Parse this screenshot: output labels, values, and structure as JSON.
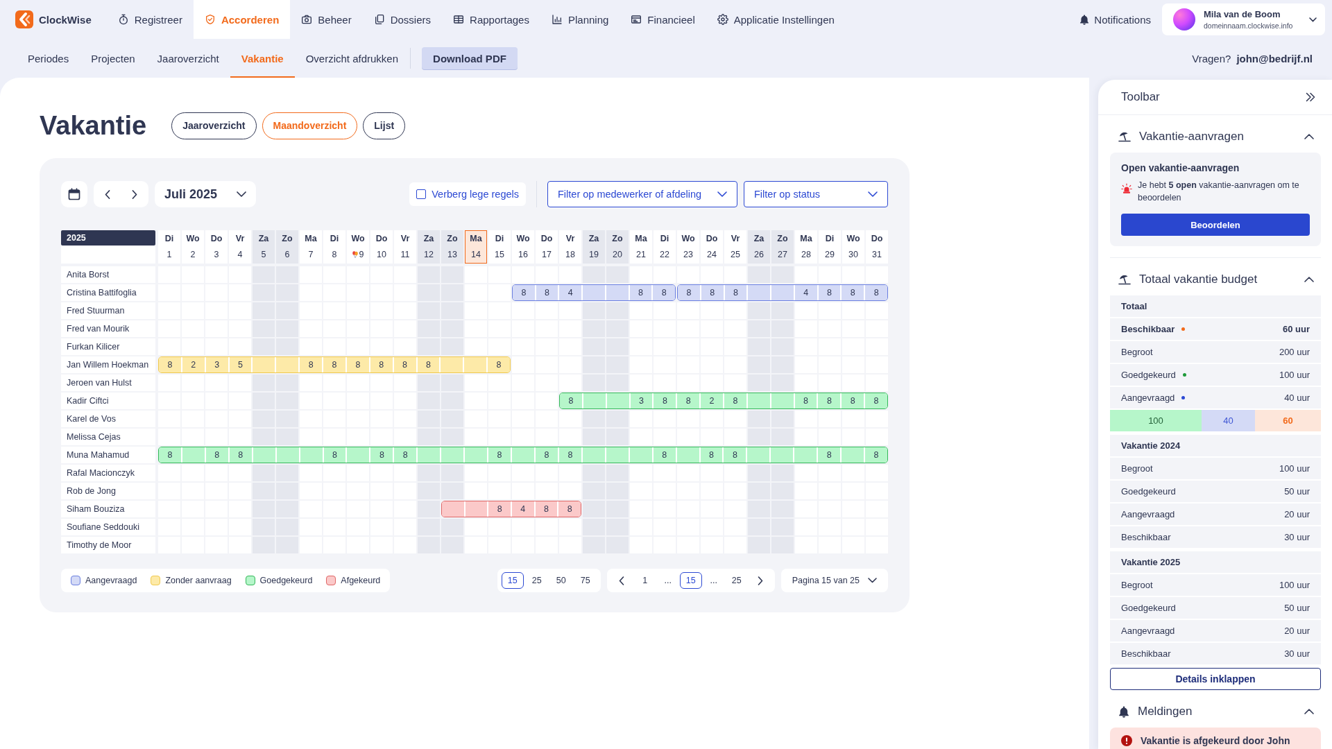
{
  "app": {
    "name": "ClockWise"
  },
  "nav": [
    {
      "label": "Registreer",
      "selected": false
    },
    {
      "label": "Accorderen",
      "selected": true
    },
    {
      "label": "Beheer",
      "selected": false
    },
    {
      "label": "Dossiers",
      "selected": false
    },
    {
      "label": "Rapportages",
      "selected": false
    },
    {
      "label": "Planning",
      "selected": false
    },
    {
      "label": "Financieel",
      "selected": false
    },
    {
      "label": "Applicatie Instellingen",
      "selected": false
    }
  ],
  "notifications": {
    "label": "Notifications"
  },
  "user": {
    "name": "Mila van de Boom",
    "domain": "domeinnaam.clockwise.info"
  },
  "subnav": {
    "items": [
      {
        "label": "Periodes",
        "selected": false
      },
      {
        "label": "Projecten",
        "selected": false
      },
      {
        "label": "Jaaroverzicht",
        "selected": false
      },
      {
        "label": "Vakantie",
        "selected": true
      },
      {
        "label": "Overzicht afdrukken",
        "selected": false
      }
    ],
    "download_button": "Download PDF",
    "help_label": "Vragen?",
    "help_email": "john@bedrijf.nl"
  },
  "page": {
    "title": "Vakantie",
    "views": [
      {
        "label": "Jaaroverzicht",
        "selected": false
      },
      {
        "label": "Maandoverzicht",
        "selected": true
      },
      {
        "label": "Lijst",
        "selected": false
      }
    ]
  },
  "calendar": {
    "month": "Juli 2025",
    "hide_empty_rows": {
      "label": "Verberg lege regels",
      "checked": false
    },
    "filters": [
      {
        "label": "Filter op medewerker of afdeling"
      },
      {
        "label": "Filter op status"
      }
    ],
    "year": "2025",
    "days": [
      {
        "weekday": "Di",
        "number": "1",
        "weekend": false,
        "today": false,
        "balloons": false
      },
      {
        "weekday": "Wo",
        "number": "2",
        "weekend": false,
        "today": false,
        "balloons": false
      },
      {
        "weekday": "Do",
        "number": "3",
        "weekend": false,
        "today": false,
        "balloons": false
      },
      {
        "weekday": "Vr",
        "number": "4",
        "weekend": false,
        "today": false,
        "balloons": false
      },
      {
        "weekday": "Za",
        "number": "5",
        "weekend": true,
        "today": false,
        "balloons": false
      },
      {
        "weekday": "Zo",
        "number": "6",
        "weekend": true,
        "today": false,
        "balloons": false
      },
      {
        "weekday": "Ma",
        "number": "7",
        "weekend": false,
        "today": false,
        "balloons": false
      },
      {
        "weekday": "Di",
        "number": "8",
        "weekend": false,
        "today": false,
        "balloons": false
      },
      {
        "weekday": "Wo",
        "number": "9",
        "weekend": false,
        "today": false,
        "balloons": true
      },
      {
        "weekday": "Do",
        "number": "10",
        "weekend": false,
        "today": false,
        "balloons": false
      },
      {
        "weekday": "Vr",
        "number": "11",
        "weekend": false,
        "today": false,
        "balloons": false
      },
      {
        "weekday": "Za",
        "number": "12",
        "weekend": true,
        "today": false,
        "balloons": false
      },
      {
        "weekday": "Zo",
        "number": "13",
        "weekend": true,
        "today": false,
        "balloons": false
      },
      {
        "weekday": "Ma",
        "number": "14",
        "weekend": false,
        "today": true,
        "balloons": false
      },
      {
        "weekday": "Di",
        "number": "15",
        "weekend": false,
        "today": false,
        "balloons": false
      },
      {
        "weekday": "Wo",
        "number": "16",
        "weekend": false,
        "today": false,
        "balloons": false
      },
      {
        "weekday": "Do",
        "number": "17",
        "weekend": false,
        "today": false,
        "balloons": false
      },
      {
        "weekday": "Vr",
        "number": "18",
        "weekend": false,
        "today": false,
        "balloons": false
      },
      {
        "weekday": "Za",
        "number": "19",
        "weekend": true,
        "today": false,
        "balloons": false
      },
      {
        "weekday": "Zo",
        "number": "20",
        "weekend": true,
        "today": false,
        "balloons": false
      },
      {
        "weekday": "Ma",
        "number": "21",
        "weekend": false,
        "today": false,
        "balloons": false
      },
      {
        "weekday": "Di",
        "number": "22",
        "weekend": false,
        "today": false,
        "balloons": false
      },
      {
        "weekday": "Wo",
        "number": "23",
        "weekend": false,
        "today": false,
        "balloons": false
      },
      {
        "weekday": "Do",
        "number": "24",
        "weekend": false,
        "today": false,
        "balloons": false
      },
      {
        "weekday": "Vr",
        "number": "25",
        "weekend": false,
        "today": false,
        "balloons": false
      },
      {
        "weekday": "Za",
        "number": "26",
        "weekend": true,
        "today": false,
        "balloons": false
      },
      {
        "weekday": "Zo",
        "number": "27",
        "weekend": true,
        "today": false,
        "balloons": false
      },
      {
        "weekday": "Ma",
        "number": "28",
        "weekend": false,
        "today": false,
        "balloons": false
      },
      {
        "weekday": "Di",
        "number": "29",
        "weekend": false,
        "today": false,
        "balloons": false
      },
      {
        "weekday": "Wo",
        "number": "30",
        "weekend": false,
        "today": false,
        "balloons": false
      },
      {
        "weekday": "Do",
        "number": "31",
        "weekend": false,
        "today": false,
        "balloons": false
      }
    ],
    "employees": [
      {
        "name": "Anita Borst"
      },
      {
        "name": "Cristina Battifoglia",
        "items": [
          {
            "kind": "empty"
          },
          {
            "kind": "empty"
          },
          {
            "kind": "empty"
          },
          {
            "kind": "empty"
          },
          {
            "kind": "empty"
          },
          {
            "kind": "empty"
          },
          {
            "kind": "empty"
          },
          {
            "kind": "empty"
          },
          {
            "kind": "empty"
          },
          {
            "kind": "empty"
          },
          {
            "kind": "empty"
          },
          {
            "kind": "empty"
          },
          {
            "kind": "empty"
          },
          {
            "kind": "empty"
          },
          {
            "kind": "empty"
          },
          {
            "kind": "requested",
            "cells": [
              {
                "kind": "hours",
                "hours": "8"
              },
              {
                "kind": "hours",
                "hours": "8"
              },
              {
                "kind": "hours",
                "hours": "4"
              },
              {
                "kind": "blank"
              },
              {
                "kind": "blank"
              },
              {
                "kind": "hours",
                "hours": "8"
              },
              {
                "kind": "hours",
                "hours": "8"
              }
            ]
          },
          {
            "kind": "requested",
            "cells": [
              {
                "kind": "hours",
                "hours": "8"
              },
              {
                "kind": "hours",
                "hours": "8"
              },
              {
                "kind": "hours",
                "hours": "8"
              },
              {
                "kind": "blank"
              },
              {
                "kind": "blank"
              },
              {
                "kind": "hours",
                "hours": "4"
              },
              {
                "kind": "hours",
                "hours": "8"
              },
              {
                "kind": "hours",
                "hours": "8"
              },
              {
                "kind": "hours",
                "hours": "8"
              }
            ]
          }
        ]
      },
      {
        "name": "Fred Stuurman"
      },
      {
        "name": "Fred van Mourik"
      },
      {
        "name": "Furkan Kilicer"
      },
      {
        "name": "Jan Willem Hoekman",
        "items": [
          {
            "kind": "unrequested",
            "cells": [
              {
                "kind": "hours",
                "hours": "8"
              },
              {
                "kind": "hours",
                "hours": "2"
              },
              {
                "kind": "hours",
                "hours": "3"
              },
              {
                "kind": "hours",
                "hours": "5"
              },
              {
                "kind": "blank"
              },
              {
                "kind": "blank"
              },
              {
                "kind": "hours",
                "hours": "8"
              },
              {
                "kind": "hours",
                "hours": "8"
              },
              {
                "kind": "hours",
                "hours": "8"
              },
              {
                "kind": "hours",
                "hours": "8"
              },
              {
                "kind": "hours",
                "hours": "8"
              },
              {
                "kind": "hours",
                "hours": "8"
              },
              {
                "kind": "blank"
              },
              {
                "kind": "blank"
              },
              {
                "kind": "hours",
                "hours": "8"
              }
            ]
          },
          {
            "kind": "empty"
          },
          {
            "kind": "empty"
          },
          {
            "kind": "empty"
          },
          {
            "kind": "empty"
          },
          {
            "kind": "empty"
          },
          {
            "kind": "empty"
          },
          {
            "kind": "empty"
          },
          {
            "kind": "empty"
          },
          {
            "kind": "empty"
          },
          {
            "kind": "empty"
          },
          {
            "kind": "empty"
          },
          {
            "kind": "empty"
          },
          {
            "kind": "empty"
          },
          {
            "kind": "empty"
          },
          {
            "kind": "empty"
          },
          {
            "kind": "empty"
          }
        ]
      },
      {
        "name": "Jeroen van Hulst"
      },
      {
        "name": "Kadir Ciftci",
        "items": [
          {
            "kind": "empty"
          },
          {
            "kind": "empty"
          },
          {
            "kind": "empty"
          },
          {
            "kind": "empty"
          },
          {
            "kind": "empty"
          },
          {
            "kind": "empty"
          },
          {
            "kind": "empty"
          },
          {
            "kind": "empty"
          },
          {
            "kind": "empty"
          },
          {
            "kind": "empty"
          },
          {
            "kind": "empty"
          },
          {
            "kind": "empty"
          },
          {
            "kind": "empty"
          },
          {
            "kind": "empty"
          },
          {
            "kind": "empty"
          },
          {
            "kind": "empty"
          },
          {
            "kind": "empty"
          },
          {
            "kind": "approved",
            "cells": [
              {
                "kind": "hours",
                "hours": "8"
              },
              {
                "kind": "blank"
              },
              {
                "kind": "blank"
              },
              {
                "kind": "hours",
                "hours": "3"
              },
              {
                "kind": "hours",
                "hours": "8"
              },
              {
                "kind": "hours",
                "hours": "8"
              },
              {
                "kind": "hours",
                "hours": "2"
              },
              {
                "kind": "hours",
                "hours": "8"
              },
              {
                "kind": "blank"
              },
              {
                "kind": "blank"
              },
              {
                "kind": "hours",
                "hours": "8"
              },
              {
                "kind": "hours",
                "hours": "8"
              },
              {
                "kind": "hours",
                "hours": "8"
              },
              {
                "kind": "hours",
                "hours": "8"
              }
            ]
          }
        ]
      },
      {
        "name": "Karel de Vos"
      },
      {
        "name": "Melissa Cejas"
      },
      {
        "name": "Muna Mahamud",
        "items": [
          {
            "kind": "approved",
            "cells": [
              {
                "kind": "hours",
                "hours": "8"
              },
              {
                "kind": "blank"
              },
              {
                "kind": "hours",
                "hours": "8"
              },
              {
                "kind": "hours",
                "hours": "8"
              },
              {
                "kind": "blank"
              },
              {
                "kind": "blank"
              },
              {
                "kind": "blank"
              },
              {
                "kind": "hours",
                "hours": "8"
              },
              {
                "kind": "blank"
              },
              {
                "kind": "hours",
                "hours": "8"
              },
              {
                "kind": "hours",
                "hours": "8"
              },
              {
                "kind": "blank"
              },
              {
                "kind": "blank"
              },
              {
                "kind": "blank"
              },
              {
                "kind": "hours",
                "hours": "8"
              },
              {
                "kind": "blank"
              },
              {
                "kind": "hours",
                "hours": "8"
              },
              {
                "kind": "hours",
                "hours": "8"
              },
              {
                "kind": "blank"
              },
              {
                "kind": "blank"
              },
              {
                "kind": "blank"
              },
              {
                "kind": "hours",
                "hours": "8"
              },
              {
                "kind": "blank"
              },
              {
                "kind": "hours",
                "hours": "8"
              },
              {
                "kind": "hours",
                "hours": "8"
              },
              {
                "kind": "blank"
              },
              {
                "kind": "blank"
              },
              {
                "kind": "blank"
              },
              {
                "kind": "hours",
                "hours": "8"
              },
              {
                "kind": "blank"
              },
              {
                "kind": "hours",
                "hours": "8"
              }
            ]
          }
        ]
      },
      {
        "name": "Rafal Macionczyk"
      },
      {
        "name": "Rob de Jong"
      },
      {
        "name": "Siham Bouziza",
        "items": [
          {
            "kind": "empty"
          },
          {
            "kind": "empty"
          },
          {
            "kind": "empty"
          },
          {
            "kind": "empty"
          },
          {
            "kind": "empty"
          },
          {
            "kind": "empty"
          },
          {
            "kind": "empty"
          },
          {
            "kind": "empty"
          },
          {
            "kind": "empty"
          },
          {
            "kind": "empty"
          },
          {
            "kind": "empty"
          },
          {
            "kind": "empty"
          },
          {
            "kind": "rejected",
            "cells": [
              {
                "kind": "blank"
              },
              {
                "kind": "blank"
              },
              {
                "kind": "hours",
                "hours": "8"
              },
              {
                "kind": "hours",
                "hours": "4"
              },
              {
                "kind": "hours",
                "hours": "8"
              },
              {
                "kind": "hours",
                "hours": "8"
              }
            ]
          },
          {
            "kind": "empty"
          },
          {
            "kind": "empty"
          },
          {
            "kind": "empty"
          },
          {
            "kind": "empty"
          },
          {
            "kind": "empty"
          },
          {
            "kind": "empty"
          },
          {
            "kind": "empty"
          },
          {
            "kind": "empty"
          },
          {
            "kind": "empty"
          },
          {
            "kind": "empty"
          },
          {
            "kind": "empty"
          },
          {
            "kind": "empty"
          },
          {
            "kind": "empty"
          }
        ]
      },
      {
        "name": "Soufiane Seddouki"
      },
      {
        "name": "Timothy de Moor"
      }
    ],
    "legend": [
      {
        "label": "Aangevraagd",
        "kind": "requested"
      },
      {
        "label": "Zonder aanvraag",
        "kind": "unrequested"
      },
      {
        "label": "Goedgekeurd",
        "kind": "approved"
      },
      {
        "label": "Afgekeurd",
        "kind": "rejected"
      }
    ],
    "page_sizes": [
      {
        "label": "15",
        "selected": true
      },
      {
        "label": "25",
        "selected": false
      },
      {
        "label": "50",
        "selected": false
      },
      {
        "label": "75",
        "selected": false
      }
    ],
    "pages": [
      {
        "label": "1",
        "kind": "page",
        "selected": false
      },
      {
        "label": "...",
        "kind": "ellipsis",
        "selected": false
      },
      {
        "label": "15",
        "kind": "page",
        "selected": true
      },
      {
        "label": "...",
        "kind": "ellipsis",
        "selected": false
      },
      {
        "label": "25",
        "kind": "page",
        "selected": false
      }
    ],
    "page_select": "Pagina 15 van 25"
  },
  "toolbar": {
    "title": "Toolbar",
    "requests": {
      "title": "Vakantie-aanvragen",
      "expanded": true,
      "card_title": "Open vakantie-aanvragen",
      "message": "Je hebt **5 open** vakantie-aanvragen om te beoordelen",
      "button": "Beoordelen"
    },
    "budget": {
      "title": "Totaal vakantie budget",
      "expanded": true,
      "groups": [
        {
          "title": "Totaal",
          "rows": [
            {
              "label": "Beschikbaar",
              "value": "60 uur",
              "highlight": true,
              "color": "#f26a1b"
            },
            {
              "label": "Begroot",
              "value": "200 uur",
              "highlight": false
            },
            {
              "label": "Goedgekeurd",
              "value": "100 uur",
              "highlight": false,
              "color": "#1f9a3a"
            },
            {
              "label": "Aangevraagd",
              "value": "40 uur",
              "highlight": false,
              "color": "#2c49d3"
            }
          ],
          "bar": [
            {
              "label": "100",
              "kind": "approved"
            },
            {
              "label": "40",
              "kind": "requested"
            },
            {
              "label": "60",
              "kind": "available"
            }
          ]
        },
        {
          "title": "Vakantie 2024",
          "rows": [
            {
              "label": "Begroot",
              "value": "100 uur",
              "highlight": false
            },
            {
              "label": "Goedgekeurd",
              "value": "50 uur",
              "highlight": false
            },
            {
              "label": "Aangevraagd",
              "value": "20 uur",
              "highlight": false
            },
            {
              "label": "Beschikbaar",
              "value": "30 uur",
              "highlight": false
            }
          ]
        },
        {
          "title": "Vakantie 2025",
          "rows": [
            {
              "label": "Begroot",
              "value": "100 uur",
              "highlight": false
            },
            {
              "label": "Goedgekeurd",
              "value": "50 uur",
              "highlight": false
            },
            {
              "label": "Aangevraagd",
              "value": "20 uur",
              "highlight": false
            },
            {
              "label": "Beschikbaar",
              "value": "30 uur",
              "highlight": false
            }
          ]
        }
      ],
      "collapse_button": "Details inklappen"
    },
    "notifications": {
      "title": "Meldingen",
      "expanded": true,
      "items": [
        {
          "message": "Vakantie is afgekeurd door John",
          "kind": "rejected"
        }
      ]
    }
  }
}
